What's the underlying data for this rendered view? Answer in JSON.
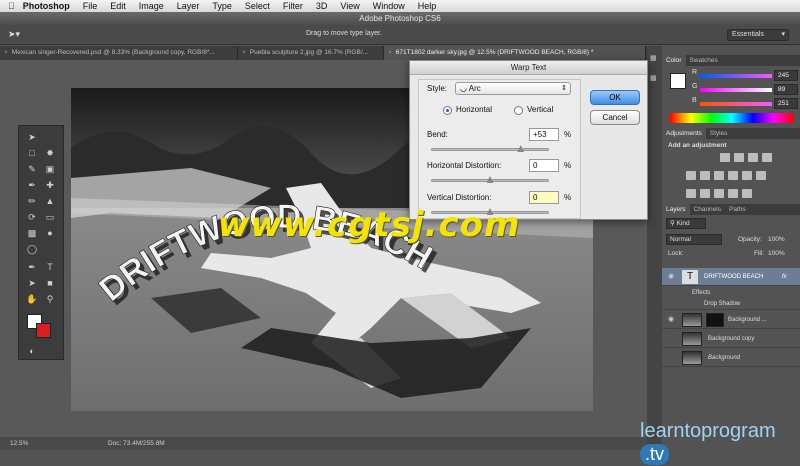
{
  "menubar": {
    "app": "Photoshop",
    "items": [
      "File",
      "Edit",
      "Image",
      "Layer",
      "Type",
      "Select",
      "Filter",
      "3D",
      "View",
      "Window",
      "Help"
    ]
  },
  "titlebar": {
    "title": "Adobe Photoshop CS6"
  },
  "options": {
    "hint": "Drag to move type layer.",
    "workspace": "Essentials"
  },
  "tabs": [
    "Mexican singer-Recovered.psd @ 8.33% (Background copy, RGB/8*...",
    "Puebla sculpture 2.jpg @ 16.7% (RGB/...",
    "671T1802 darker sky.jpg @ 12.5% (DRIFTWOOD BEACH, RGB/8) *"
  ],
  "canvas": {
    "warped_text": "DRIFTWOOD BEACH"
  },
  "status": {
    "zoom": "12.5%",
    "doc": "Doc: 73.4M/255.8M"
  },
  "dialog": {
    "title": "Warp Text",
    "style_label": "Style:",
    "style_value": "Arc",
    "horizontal": "Horizontal",
    "vertical": "Vertical",
    "bend_label": "Bend:",
    "bend_value": "+53",
    "hdist_label": "Horizontal Distortion:",
    "hdist_value": "0",
    "vdist_label": "Vertical Distortion:",
    "vdist_value": "0",
    "percent": "%",
    "ok": "OK",
    "cancel": "Cancel",
    "bend_level": 0.765,
    "hdist_level": 0.5,
    "vdist_level": 0.5
  },
  "color_panel": {
    "tabs": [
      "Color",
      "Swatches"
    ],
    "r_label": "R",
    "r_value": "245",
    "g_label": "G",
    "g_value": "89",
    "b_label": "B",
    "b_value": "251"
  },
  "adjustments": {
    "tabs": [
      "Adjustments",
      "Styles"
    ],
    "hint": "Add an adjustment"
  },
  "layers_panel": {
    "tabs": [
      "Layers",
      "Channels",
      "Paths"
    ],
    "filter": "Kind",
    "blend": "Normal",
    "opacity_label": "Opacity:",
    "opacity_value": "100%",
    "lock_label": "Lock:",
    "fill_label": "Fill:",
    "fill_value": "100%",
    "layers": [
      {
        "name": "DRIFTWOOD BEACH",
        "type": "text"
      },
      {
        "name": "Effects",
        "type": "effects"
      },
      {
        "name": "Drop Shadow",
        "type": "effect"
      },
      {
        "name": "Background ...",
        "type": "image"
      },
      {
        "name": "Background copy",
        "type": "image"
      },
      {
        "name": "Background",
        "type": "image"
      }
    ]
  },
  "watermark": "www.cgtsj.com",
  "brand": {
    "main": "learntoprogram",
    "suffix": ".tv"
  }
}
